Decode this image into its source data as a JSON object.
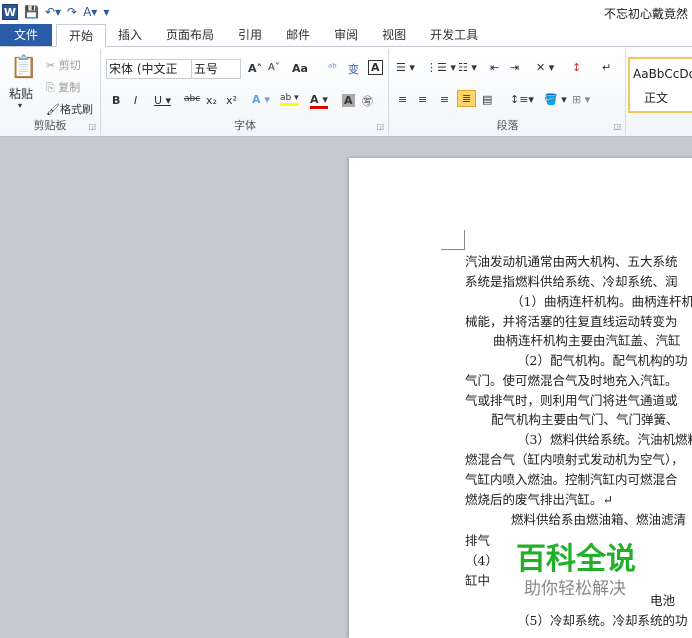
{
  "titlebar": {
    "user": "不忘初心戴竟然"
  },
  "tabs": [
    "文件",
    "开始",
    "插入",
    "页面布局",
    "引用",
    "邮件",
    "审阅",
    "视图",
    "开发工具"
  ],
  "clipboard": {
    "paste": "粘贴",
    "cut": "剪切",
    "copy": "复制",
    "format_painter": "格式刷",
    "label": "剪贴板"
  },
  "font": {
    "name": "宋体 (中文正文)",
    "size": "五号",
    "label": "字体",
    "change_case": "Aa"
  },
  "paragraph": {
    "label": "段落"
  },
  "styles": {
    "preview": "AaBbCcDd",
    "name": "正文"
  },
  "document": {
    "lines": [
      "汽油发动机通常由两大机构、五大系统",
      "系统是指燃料供给系统、冷却系统、润",
      "（1）曲柄连杆机构。曲柄连杆机",
      "械能，并将活塞的往复直线运动转变为",
      "曲柄连杆机构主要由汽缸盖、汽缸",
      "（2）配气机构。配气机构的功",
      "气门。使可燃混合气及时地充入汽缸。",
      "气或排气时，则利用气门将进气通道或",
      "配气机构主要由气门、气门弹簧、",
      "（3）燃料供给系统。汽油机燃料",
      "燃混合气（缸内喷射式发动机为空气），",
      "气缸内喷入燃油。控制汽缸内可燃混合",
      "燃烧后的废气排出汽缸。↵",
      "燃料供给系由燃油箱、燃油滤清",
      "排气",
      "（4）",
      "缸中",
      "电池",
      "（5）冷却系统。冷却系统的功"
    ]
  },
  "watermark": {
    "title": "百科全说",
    "subtitle": "助你轻松解决"
  }
}
